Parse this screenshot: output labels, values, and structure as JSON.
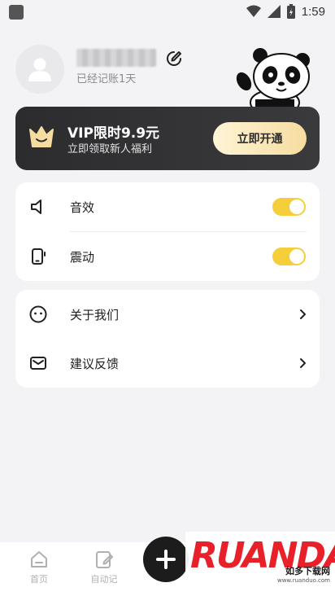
{
  "status_bar": {
    "time": "1:59"
  },
  "profile": {
    "days_text": "已经记账1天"
  },
  "vip": {
    "title": "VIP限时9.9元",
    "subtitle": "立即领取新人福利",
    "button_label": "立即开通"
  },
  "settings": {
    "sound_label": "音效",
    "sound_enabled": true,
    "vibration_label": "震动",
    "vibration_enabled": true
  },
  "menu": {
    "about_label": "关于我们",
    "feedback_label": "建议反馈"
  },
  "bottom_nav": {
    "home_label": "首页",
    "auto_label": "自动记"
  },
  "watermark": {
    "brand": "RUANDADO",
    "cn": "如多下载网",
    "url": "www.ruanduo.com"
  },
  "colors": {
    "accent": "#f5cf3b",
    "vip_bg": "#2c2c2e",
    "background": "#f3f3f5"
  }
}
